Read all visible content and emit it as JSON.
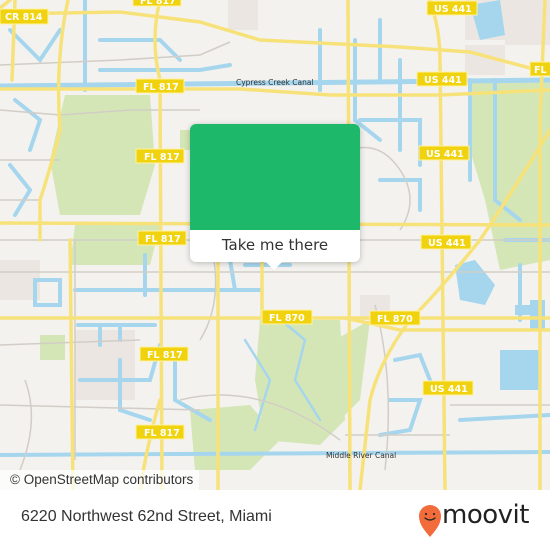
{
  "map": {
    "colors": {
      "background": "#f3f2ef",
      "road_major": "#f7e27a",
      "road_minor": "#d2cdc6",
      "water": "#a6d6ee",
      "green": "#d4e6b5",
      "urban": "#ebe6e2",
      "shield_fill": "#f0d20e",
      "popup_image": "#1eb86b"
    },
    "road_labels": [
      {
        "text": "CR 814"
      },
      {
        "text": "FL 817"
      },
      {
        "text": "FL 817"
      },
      {
        "text": "FL 817"
      },
      {
        "text": "FL 817"
      },
      {
        "text": "FL 817"
      },
      {
        "text": "FL 817"
      },
      {
        "text": "US 441"
      },
      {
        "text": "US 441"
      },
      {
        "text": "US 441"
      },
      {
        "text": "US 441"
      },
      {
        "text": "US 441"
      },
      {
        "text": "FL 870"
      },
      {
        "text": "FL 870"
      },
      {
        "text": "FL"
      }
    ],
    "water_labels": [
      {
        "text": "Cypress Creek Canal"
      },
      {
        "text": "Middle River Canal"
      }
    ],
    "attribution": "© OpenStreetMap contributors"
  },
  "popup": {
    "button_label": "Take me there"
  },
  "footer": {
    "address": "6220 Northwest 62nd Street, Miami",
    "logo_text": "moovit",
    "logo_color": "#f26b3a"
  }
}
